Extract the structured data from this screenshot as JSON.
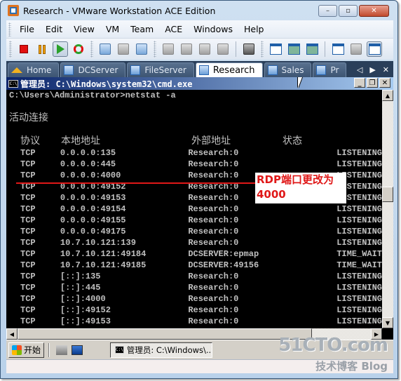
{
  "window": {
    "title": "Research - VMware Workstation ACE Edition",
    "controls": {
      "minimize": "–",
      "maximize": "▫",
      "close": "✕"
    }
  },
  "menu": [
    "File",
    "Edit",
    "View",
    "VM",
    "Team",
    "ACE",
    "Windows",
    "Help"
  ],
  "toolbar": {
    "icons": [
      "stop-icon",
      "pause-icon",
      "play-icon",
      "reset-icon",
      "take-snapshot-icon",
      "revert-snapshot-icon",
      "snapshot-manager-icon",
      "team-power-on-icon",
      "team-power-off-icon",
      "new-vm-icon",
      "usb-device-icon",
      "vm-settings-icon",
      "sidebar-view-icon",
      "quick-switch-icon",
      "full-screen-icon",
      "console-view-icon",
      "summary-view-icon",
      "unity-view-icon"
    ]
  },
  "tabs": [
    {
      "label": "Home",
      "icon": "home-icon",
      "active": false
    },
    {
      "label": "DCServer",
      "icon": "vm-running-icon",
      "active": false
    },
    {
      "label": "FileServer",
      "icon": "vm-icon",
      "active": false
    },
    {
      "label": "Research",
      "icon": "vm-running-icon",
      "active": true
    },
    {
      "label": "Sales",
      "icon": "vm-running-icon",
      "active": false
    },
    {
      "label": "Pr",
      "icon": "vm-icon",
      "active": false
    }
  ],
  "tab_nav": {
    "prev": "◁",
    "next": "▶",
    "close": "✕"
  },
  "cmd": {
    "title": "管理员: C:\\Windows\\system32\\cmd.exe",
    "icon_text": "C:\\",
    "controls": {
      "minimize": "_",
      "restore": "🗗",
      "close": "✕"
    },
    "prompt": "C:\\Users\\Administrator>netstat -a",
    "section_title": "活动连接",
    "headers": {
      "proto": "协议",
      "local": "本地地址",
      "foreign": "外部地址",
      "state": "状态"
    },
    "rows": [
      {
        "proto": "TCP",
        "local": "0.0.0.0:135",
        "foreign": "Research:0",
        "state": "LISTENING"
      },
      {
        "proto": "TCP",
        "local": "0.0.0.0:445",
        "foreign": "Research:0",
        "state": "LISTENING"
      },
      {
        "proto": "TCP",
        "local": "0.0.0.0:4000",
        "foreign": "Research:0",
        "state": "LISTENING"
      },
      {
        "proto": "TCP",
        "local": "0.0.0.0:49152",
        "foreign": "Research:0",
        "state": "LISTENING"
      },
      {
        "proto": "TCP",
        "local": "0.0.0.0:49153",
        "foreign": "Research:0",
        "state": "LISTENING"
      },
      {
        "proto": "TCP",
        "local": "0.0.0.0:49154",
        "foreign": "Research:0",
        "state": "LISTENING"
      },
      {
        "proto": "TCP",
        "local": "0.0.0.0:49155",
        "foreign": "Research:0",
        "state": "LISTENING"
      },
      {
        "proto": "TCP",
        "local": "0.0.0.0:49175",
        "foreign": "Research:0",
        "state": "LISTENING"
      },
      {
        "proto": "TCP",
        "local": "10.7.10.121:139",
        "foreign": "Research:0",
        "state": "LISTENING"
      },
      {
        "proto": "TCP",
        "local": "10.7.10.121:49184",
        "foreign": "DCSERVER:epmap",
        "state": "TIME_WAIT"
      },
      {
        "proto": "TCP",
        "local": "10.7.10.121:49185",
        "foreign": "DCSERVER:49156",
        "state": "TIME_WAIT"
      },
      {
        "proto": "TCP",
        "local": "[::]:135",
        "foreign": "Research:0",
        "state": "LISTENING"
      },
      {
        "proto": "TCP",
        "local": "[::]:445",
        "foreign": "Research:0",
        "state": "LISTENING"
      },
      {
        "proto": "TCP",
        "local": "[::]:4000",
        "foreign": "Research:0",
        "state": "LISTENING"
      },
      {
        "proto": "TCP",
        "local": "[::]:49152",
        "foreign": "Research:0",
        "state": "LISTENING"
      },
      {
        "proto": "TCP",
        "local": "[::]:49153",
        "foreign": "Research:0",
        "state": "LISTENING"
      }
    ],
    "scroll": {
      "up": "▲",
      "down": "▼",
      "left": "◀",
      "right": "▶"
    }
  },
  "annotation": {
    "line1": "RDP端口更改为",
    "line2": "4000",
    "color": "#e01818"
  },
  "taskbar": {
    "start_label": "开始",
    "task_label": "管理员: C:\\Windows\\..."
  },
  "watermark": {
    "site": "51CTO.com",
    "sub": "技术博客 Blog"
  }
}
